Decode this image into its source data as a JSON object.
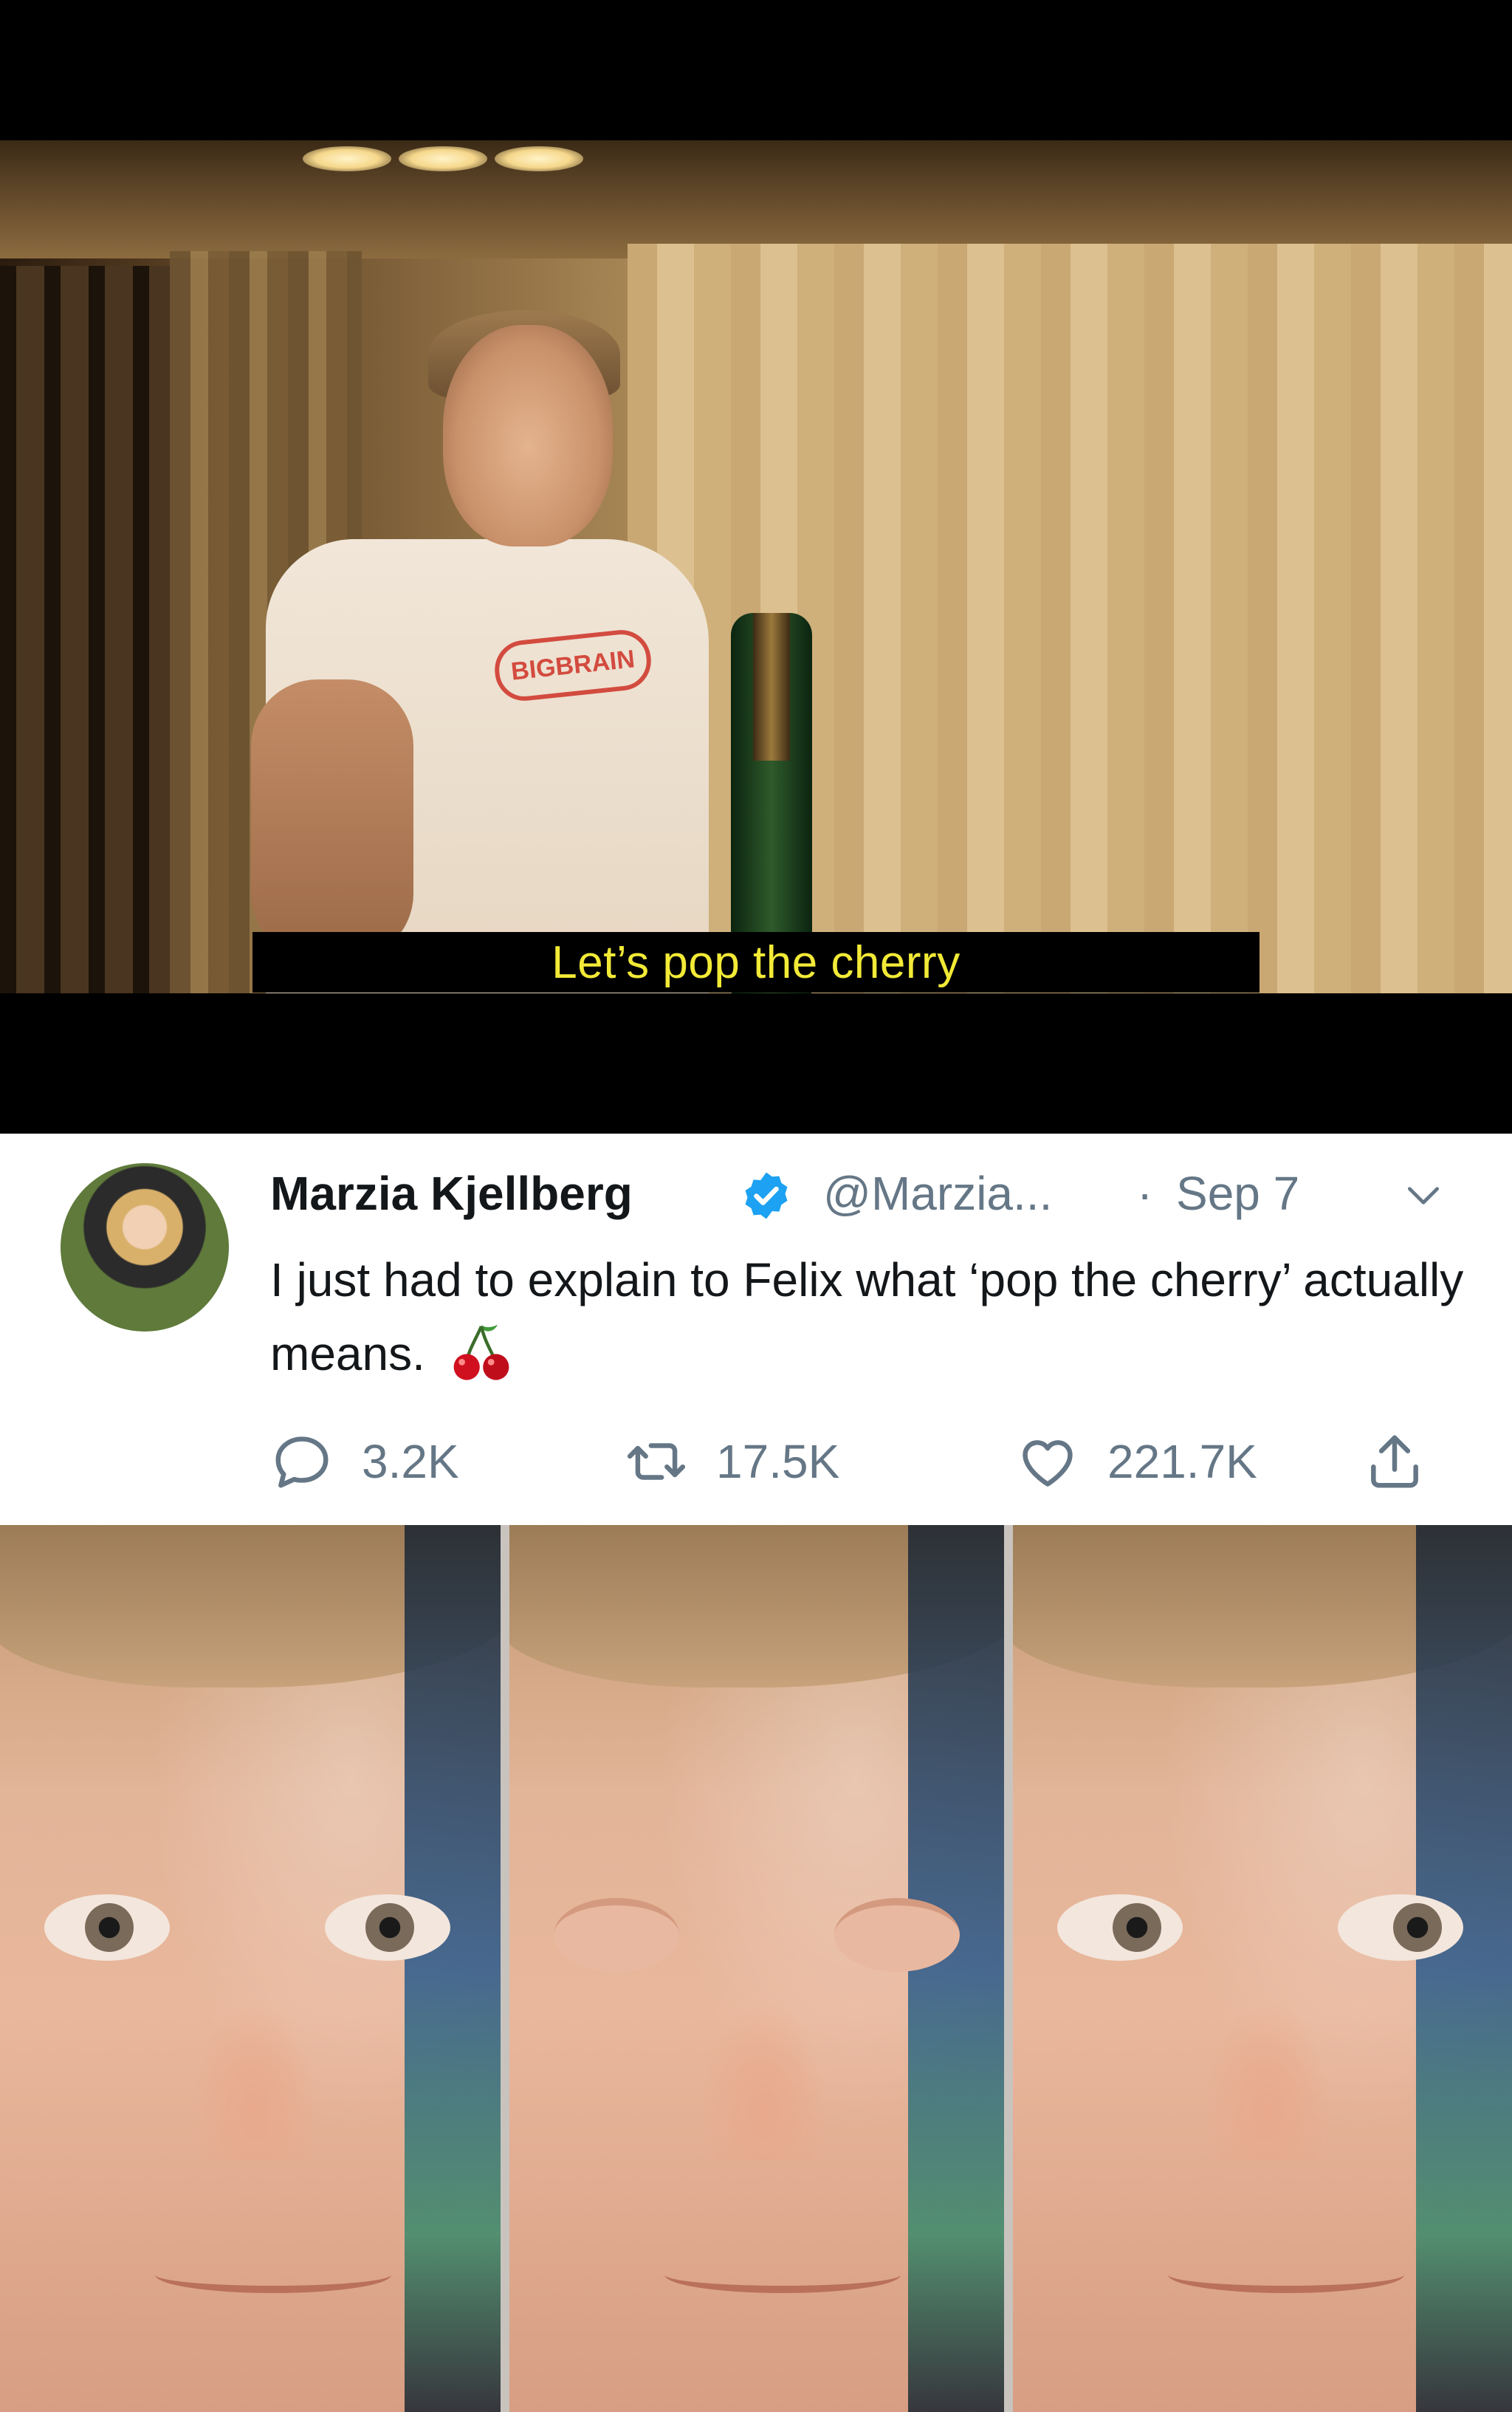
{
  "video": {
    "subtitle": "Let’s pop the cherry",
    "shirt_logo": "BIGBRAIN"
  },
  "tweet": {
    "display_name": "Marzia Kjellberg",
    "verified": true,
    "handle": "@Marzia...",
    "separator": "·",
    "date": "Sep 7",
    "text": "I just had to explain to Felix what ‘pop the cherry’ actually means.",
    "emoji": "cherries",
    "actions": {
      "replies": "3.2K",
      "retweets": "17.5K",
      "likes": "221.7K"
    },
    "colors": {
      "verified_blue": "#1da1f2",
      "muted_text": "#657786",
      "body_text": "#14171a"
    },
    "icons": [
      "verified-icon",
      "chevron-down-icon",
      "reply-icon",
      "retweet-icon",
      "like-icon",
      "share-icon",
      "cherry-icon"
    ]
  },
  "blink_panels": [
    {
      "state": "open"
    },
    {
      "state": "closed"
    },
    {
      "state": "open"
    }
  ]
}
